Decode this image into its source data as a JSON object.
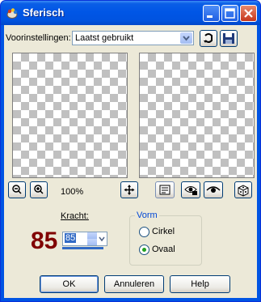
{
  "window": {
    "title": "Sferisch"
  },
  "presets": {
    "label": "Voorinstellingen:",
    "value": "Laatst gebruikt"
  },
  "zoom": {
    "value": "100%"
  },
  "strength": {
    "label": "Kracht:",
    "big_value": "85",
    "field_value": "85"
  },
  "shape": {
    "title": "Vorm",
    "options": [
      "Cirkel",
      "Ovaal"
    ],
    "selected": "Ovaal"
  },
  "buttons": {
    "ok": "OK",
    "cancel": "Annuleren",
    "help": "Help"
  },
  "colors": {
    "titlebar": "#0054e3",
    "client": "#ece9d8",
    "big_value": "#800000",
    "group_title": "#0046d5"
  }
}
